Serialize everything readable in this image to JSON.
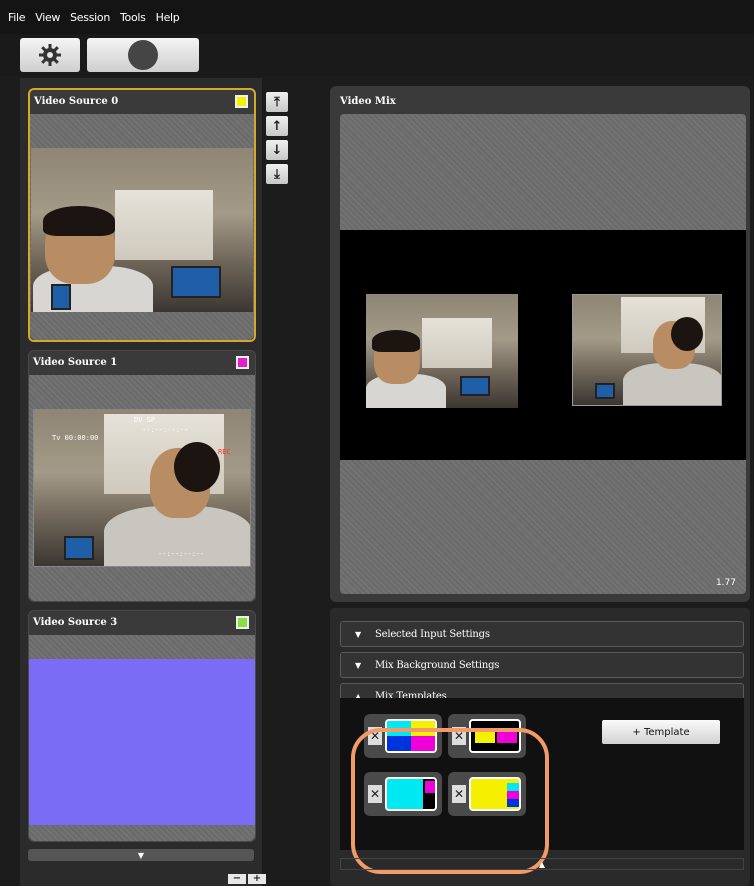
{
  "menubar": {
    "items": [
      "File",
      "View",
      "Session",
      "Tools",
      "Help"
    ]
  },
  "toolbar": {
    "settings_icon": "gear-icon",
    "record_icon": "record-icon"
  },
  "side_tools": {
    "icons": [
      "move-top-icon",
      "move-up-icon",
      "move-down-icon",
      "move-bottom-icon"
    ],
    "glyphs": [
      "⤒",
      "↑",
      "↓",
      "⤓"
    ]
  },
  "sources": [
    {
      "title": "Video Source 0",
      "color": "#f2f200",
      "selected": true
    },
    {
      "title": "Video Source 1",
      "color": "#e020d0",
      "selected": false
    },
    {
      "title": "Video Source 3",
      "color": "#88e040",
      "selected": false,
      "fill": "#7b6cf6"
    }
  ],
  "osd": {
    "tv": "Tv",
    "counter": "00:00:00",
    "timecode": "--:--:--:--",
    "dv": "DV",
    "sp": "SP",
    "rec": "REC"
  },
  "zoom": {
    "minus": "−",
    "plus": "+"
  },
  "mix": {
    "title": "Video Mix",
    "aspect": "1.77"
  },
  "accordion": [
    {
      "label": "Selected Input Settings",
      "arrow": "▼"
    },
    {
      "label": "Mix Background Settings",
      "arrow": "▼"
    },
    {
      "label": "Mix Templates",
      "arrow": "▲"
    }
  ],
  "templates": {
    "add_label": "+ Template",
    "remove_glyph": "✕"
  },
  "scroll": {
    "down": "▼",
    "up": "▲"
  }
}
